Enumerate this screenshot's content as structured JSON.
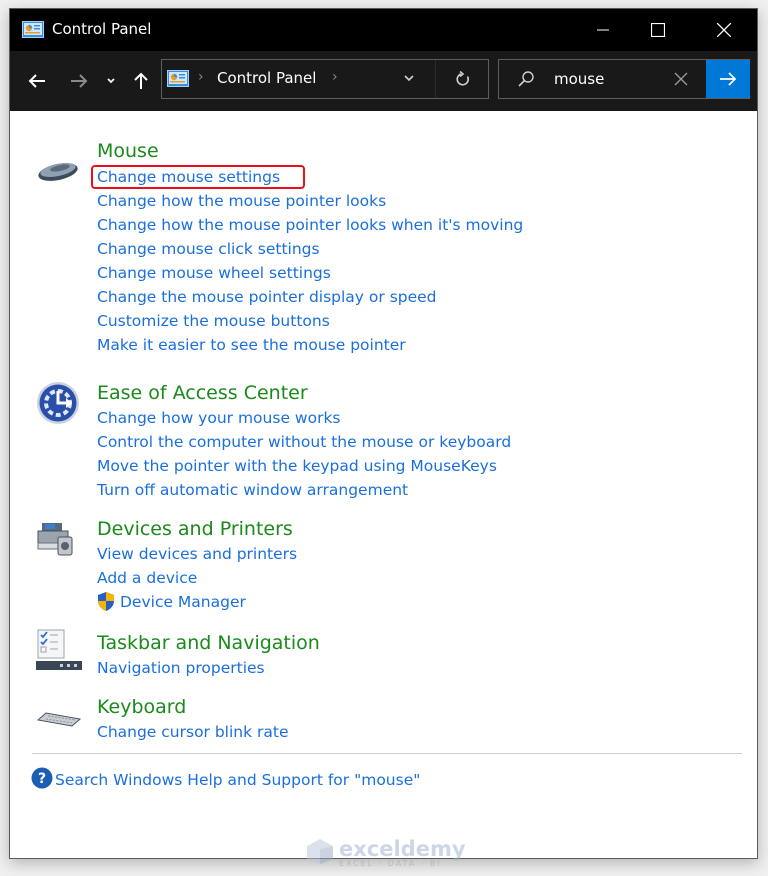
{
  "window": {
    "title": "Control Panel",
    "controls": {
      "minimize": "minimize",
      "maximize": "maximize",
      "close": "close"
    }
  },
  "navigation": {
    "breadcrumb": [
      "Control Panel"
    ],
    "search": {
      "value": "mouse",
      "placeholder": ""
    }
  },
  "sections": [
    {
      "title": "Mouse",
      "icon": "mouse-icon",
      "links": [
        "Change mouse settings",
        "Change how the mouse pointer looks",
        "Change how the mouse pointer looks when it's moving",
        "Change mouse click settings",
        "Change mouse wheel settings",
        "Change the mouse pointer display or speed",
        "Customize the mouse buttons",
        "Make it easier to see the mouse pointer"
      ],
      "highlighted_link": "Change mouse settings"
    },
    {
      "title": "Ease of Access Center",
      "icon": "ease-of-access-icon",
      "links": [
        "Change how your mouse works",
        "Control the computer without the mouse or keyboard",
        "Move the pointer with the keypad using MouseKeys",
        "Turn off automatic window arrangement"
      ]
    },
    {
      "title": "Devices and Printers",
      "icon": "devices-printers-icon",
      "links": [
        "View devices and printers",
        "Add a device",
        "Device Manager"
      ]
    },
    {
      "title": "Taskbar and Navigation",
      "icon": "taskbar-icon",
      "links": [
        "Navigation properties"
      ]
    },
    {
      "title": "Keyboard",
      "icon": "keyboard-icon",
      "links": [
        "Change cursor blink rate"
      ]
    }
  ],
  "help_link": "Search Windows Help and Support for \"mouse\"",
  "watermark": {
    "name": "exceldemy",
    "tagline": "EXCEL · DATA · BI"
  },
  "colors": {
    "section_title": "#1a8a1a",
    "link": "#1a6fde",
    "highlight_border": "#e8101b",
    "search_go": "#0078d7",
    "titlebar": "#000000",
    "navbar": "#191919"
  }
}
